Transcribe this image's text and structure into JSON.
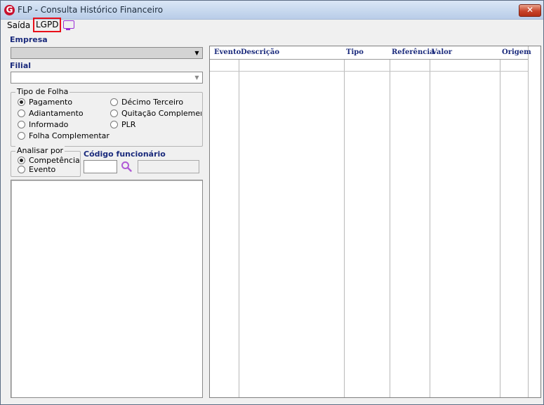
{
  "window": {
    "title": "FLP - Consulta Histórico Financeiro",
    "app_icon": "flp-logo",
    "close_icon": "close-icon"
  },
  "menu": {
    "saida": "Saída",
    "lgpd": "LGPD",
    "monitor_icon": "monitor-icon"
  },
  "empresa": {
    "label": "Empresa",
    "value": ""
  },
  "filial": {
    "label": "Filial",
    "value": ""
  },
  "tipo_folha": {
    "label": "Tipo de Folha",
    "options": [
      {
        "label": "Pagamento",
        "checked": true
      },
      {
        "label": "Adiantamento",
        "checked": false
      },
      {
        "label": "Informado",
        "checked": false
      },
      {
        "label": "Folha Complementar",
        "checked": false
      },
      {
        "label": "Décimo Terceiro",
        "checked": false
      },
      {
        "label": "Quitação Complementar",
        "checked": false
      },
      {
        "label": "PLR",
        "checked": false
      }
    ]
  },
  "analisar_por": {
    "label": "Analisar por",
    "options": [
      {
        "label": "Competência",
        "checked": true
      },
      {
        "label": "Evento",
        "checked": false
      }
    ]
  },
  "codigo_funcionario": {
    "label": "Código funcionário",
    "value": "",
    "name_value": "",
    "search_icon": "search-icon"
  },
  "grid": {
    "columns": [
      "Evento",
      "Descrição",
      "Tipo",
      "Referência",
      "Valor",
      "Origem"
    ],
    "rows": []
  },
  "colors": {
    "accent_label": "#1a2a7c",
    "highlight_border": "#e8101a",
    "icon_purple": "#9a2fd6"
  }
}
